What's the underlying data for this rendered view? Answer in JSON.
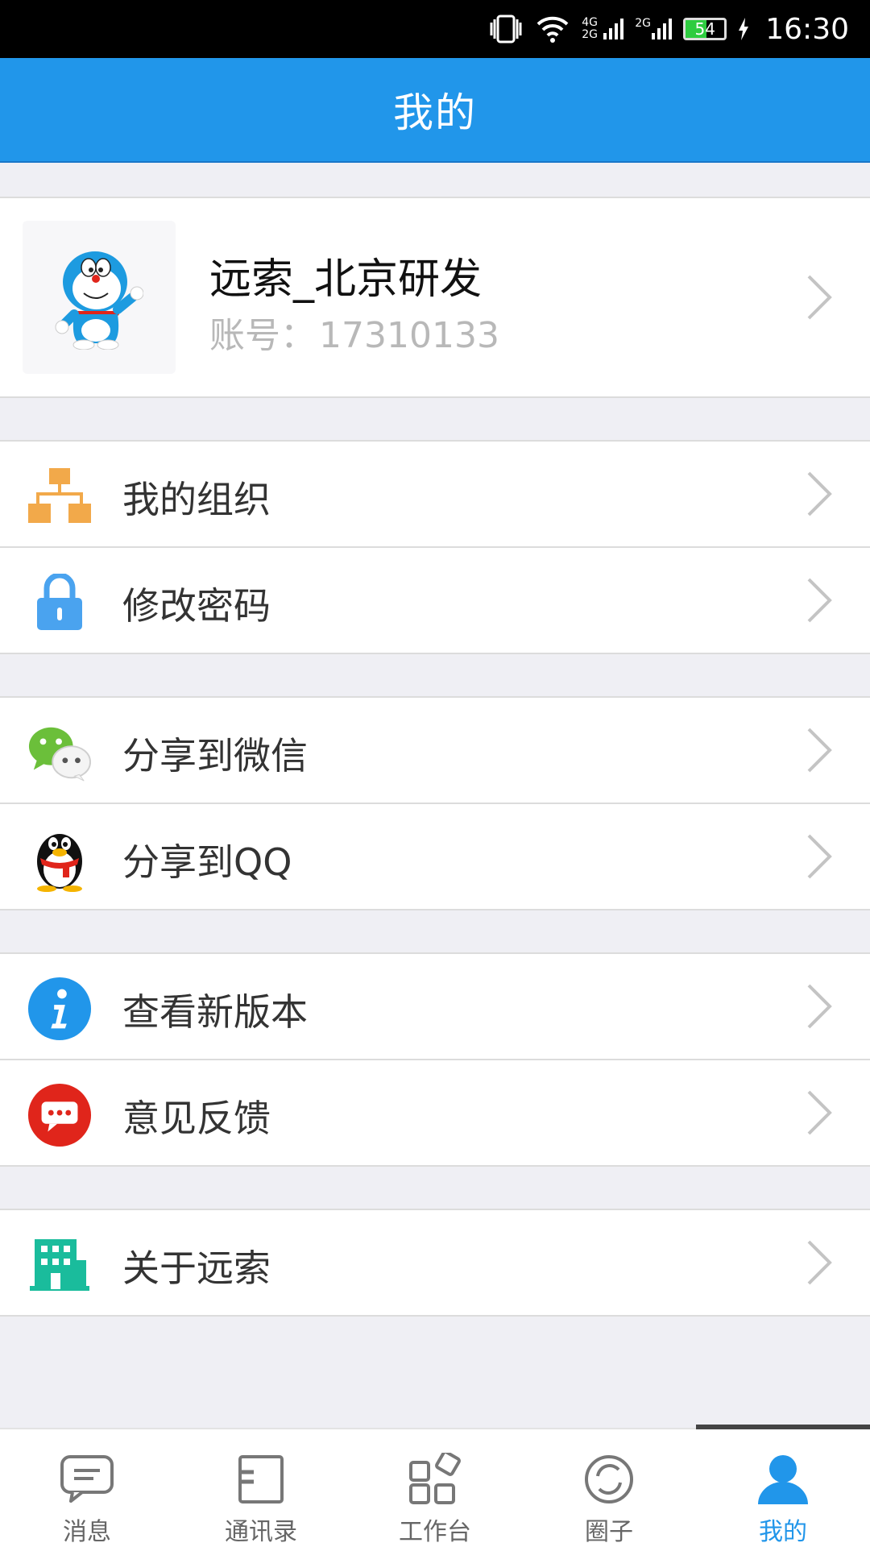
{
  "status_bar": {
    "network_1": "4G 2G",
    "network_2": "2G",
    "battery": "54",
    "time": "16:30"
  },
  "header": {
    "title": "我的"
  },
  "profile": {
    "name": "远索_北京研发",
    "account_label": "账号：",
    "account_value": "17310133"
  },
  "menu": {
    "organization": "我的组织",
    "change_password": "修改密码",
    "share_wechat": "分享到微信",
    "share_qq": "分享到QQ",
    "check_version": "查看新版本",
    "feedback": "意见反馈",
    "about": "关于远索"
  },
  "tabs": [
    {
      "label": "消息",
      "icon": "chat-icon"
    },
    {
      "label": "通讯录",
      "icon": "contacts-icon"
    },
    {
      "label": "工作台",
      "icon": "workbench-icon"
    },
    {
      "label": "圈子",
      "icon": "circle-icon"
    },
    {
      "label": "我的",
      "icon": "person-icon",
      "active": true
    }
  ],
  "colors": {
    "accent": "#2196ea",
    "background": "#efeff4",
    "org_icon": "#f2a94a",
    "lock_icon": "#4aa3ef",
    "info_icon": "#2196ea",
    "feedback_icon": "#e0251b",
    "about_icon": "#1abc9c"
  }
}
